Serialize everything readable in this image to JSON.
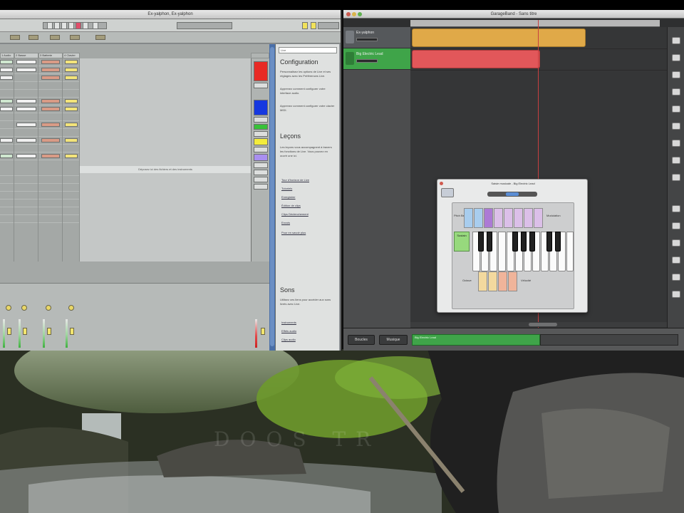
{
  "live": {
    "title": "Ex-yalphon, Ex-yalphon",
    "info": {
      "search_value": "Live",
      "section1": "Configuration",
      "text1": "Personnalisez les options de Live et ses réglages avec les Préférences Live.",
      "text2": "Apprenez comment configurer votre interface audio.",
      "text3": "Apprenez comment configurer votre clavier MIDI.",
      "section2": "Leçons",
      "text4": "Les leçons vous accompagnent à travers les fonctions de Live. Vous pouvez en ouvrir une ici.",
      "links1": [
        "Tour d'horizon de Live",
        "Tutoriels",
        "Enregistrer",
        "Édition de clips",
        "Clips Déclenchement",
        "Envois",
        "Pour en savoir plus"
      ],
      "section3": "Sons",
      "text5": "Utilisez ces liens pour accéder aux sons livrés avec Live.",
      "links2": [
        "Instruments",
        "Effets audio",
        "Clips audio"
      ]
    },
    "session": {
      "columns": [
        "1 Audio",
        "2 Basse",
        "3 Batterie",
        "4 Clavier"
      ],
      "drop_text": "Déposez ici des fichiers et des instruments"
    }
  },
  "garageband": {
    "title": "GarageBand - Sans titre",
    "tracks": [
      {
        "name": "Ex-yalphon",
        "color": "#5c5f63"
      },
      {
        "name": "Big Electric Lead",
        "color": "#3fa449"
      }
    ],
    "bottom": {
      "btn1": "Boucles",
      "btn2": "Musique",
      "region_label": "Big Electric Lead"
    }
  },
  "typing": {
    "title": "Saisie musicale - Big Electric Lead",
    "pitch_bend": "Pitch Bend",
    "modulation": "Modulation",
    "sustain": "Sustain",
    "octave": "Octave",
    "velocity": "Vélocité"
  },
  "wallpaper": {
    "watermark": "DOOS TR"
  },
  "colors": {
    "track_gold": "#e0a948",
    "track_red": "#e2575a",
    "accent_green": "#3fa449",
    "live_blue": "#4a6fa8"
  }
}
